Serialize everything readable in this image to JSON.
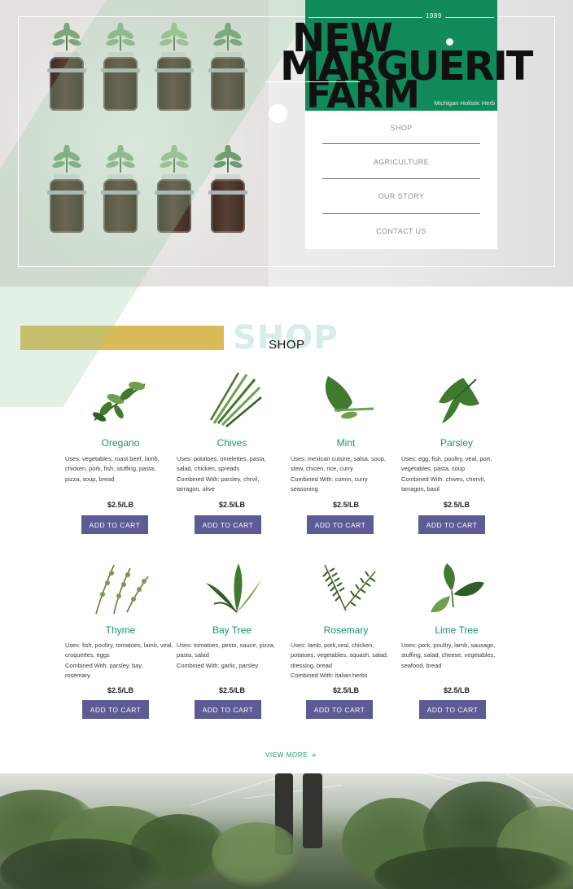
{
  "brand": {
    "year": "1989",
    "title_lines": [
      "NEW",
      "MARGUERIT",
      "FARM"
    ],
    "tagline": "Michigan Holistic Herb"
  },
  "nav": {
    "items": [
      "SHOP",
      "AGRICULTURE",
      "OUR STORY",
      "CONTACT US"
    ]
  },
  "shop": {
    "ghost_title": "SHOP",
    "title": "SHOP"
  },
  "products": [
    {
      "name": "Oregano",
      "desc": [
        "Uses: vegetables, roast beef, lamb,",
        "chicken, pork, fish, stuffing, pasta,",
        "pizza, soup, bread"
      ],
      "price": "$2.5/LB",
      "button": "ADD TO CART",
      "icon": "oregano-sprig-icon"
    },
    {
      "name": "Chives",
      "desc": [
        "Uses: potatoes, omelettes, pasta,",
        "salad, chicken, spreads",
        "Combined With: parsley, chrvil,",
        "tarragon, olive"
      ],
      "price": "$2.5/LB",
      "button": "ADD TO CART",
      "icon": "chives-icon"
    },
    {
      "name": "Mint",
      "desc": [
        "Uses: mexican cuisine, salsa, soup,",
        "stew, chicen, rice, curry",
        "Combined With: cumin, curry",
        "seasoning"
      ],
      "price": "$2.5/LB",
      "button": "ADD TO CART",
      "icon": "mint-leaf-icon"
    },
    {
      "name": "Parsley",
      "desc": [
        "Uses: egg, fish, poultry, veal, port,",
        "vegetables, pasta, soup",
        "Combined With: chives, chervil,",
        "tarragon, basil"
      ],
      "price": "$2.5/LB",
      "button": "ADD TO CART",
      "icon": "parsley-icon"
    },
    {
      "name": "Thyme",
      "desc": [
        "Uses: fish, poultry, tomatoes, lamb, veal,",
        "croquettes, eggs",
        "Combined With: parsley, bay,",
        "rosemary"
      ],
      "price": "$2.5/LB",
      "button": "ADD TO CART",
      "icon": "thyme-icon"
    },
    {
      "name": "Bay Tree",
      "desc": [
        "Uses: tomatoes, pesto, sauce, pizza,",
        "pasta, salad",
        "Combined With: garlic, parsley"
      ],
      "price": "$2.5/LB",
      "button": "ADD TO CART",
      "icon": "bay-leaf-icon"
    },
    {
      "name": "Rosemary",
      "desc": [
        "Uses: lamb, pork,veal, chicken,",
        "potatoes, vegetables, squash, salad,",
        "dressing, bread",
        "Combined With: italian herbs"
      ],
      "price": "$2.5/LB",
      "button": "ADD TO CART",
      "icon": "rosemary-icon"
    },
    {
      "name": "Lime Tree",
      "desc": [
        "Uses: pork, poultry, lamb, sausage,",
        "stuffing, salad, cheese, vegetables,",
        "seafood, bread"
      ],
      "price": "$2.5/LB",
      "button": "ADD TO CART",
      "icon": "lime-leaf-icon"
    }
  ],
  "view_more": {
    "label": "VIEW MORE",
    "icon": "double-chevron-down-icon"
  },
  "colors": {
    "brand_green": "#0f8a58",
    "product_name_green": "#119a63",
    "button_purple": "#5c5b93",
    "accent_gold": "#dbbb58",
    "ghost_mint": "#d6eeea"
  }
}
